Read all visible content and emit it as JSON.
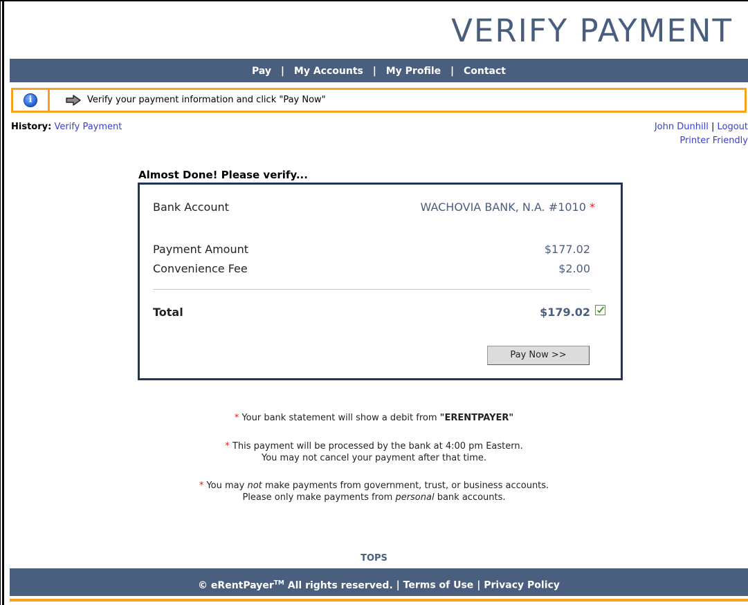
{
  "header": {
    "title": "VERIFY PAYMENT"
  },
  "nav": {
    "items": [
      "Pay",
      "My Accounts",
      "My Profile",
      "Contact"
    ],
    "separator": "|"
  },
  "notice": {
    "text": "Verify your payment information and click \"Pay Now\"",
    "info_icon": "i"
  },
  "history": {
    "label": "History:",
    "link": "Verify Payment"
  },
  "user": {
    "name": "John Dunhill",
    "separator": "|",
    "logout": "Logout",
    "printer": "Printer Friendly"
  },
  "verify": {
    "heading": "Almost Done! Please verify...",
    "bank_label": "Bank Account",
    "bank_value": "WACHOVIA BANK, N.A. #1010",
    "star": "*",
    "amount_label": "Payment Amount",
    "amount_value": "$177.02",
    "fee_label": "Convenience Fee",
    "fee_value": "$2.00",
    "total_label": "Total",
    "total_value": "$179.02",
    "button": "Pay Now >>"
  },
  "notes": {
    "note1_text": "Your bank statement will show a debit from",
    "note1_bold": "\"ERENTPAYER\"",
    "note2_line1": "This payment will be processed by the bank at 4:00 pm Eastern.",
    "note2_line2": "You may not cancel your payment after that time.",
    "note3_pre": "You may",
    "note3_em": "not",
    "note3_post": "make payments from government, trust, or business accounts.",
    "note3_line2_pre": "Please only make payments from",
    "note3_line2_em": "personal",
    "note3_line2_post": "bank accounts."
  },
  "footer": {
    "tops": "TOPS",
    "copyright": "© eRentPayer",
    "tm": "TM",
    "rights": "All rights reserved.",
    "terms": "Terms of Use",
    "privacy": "Privacy Policy",
    "separator": "|"
  },
  "colors": {
    "nav_bg": "#4a5e7d",
    "accent_orange": "#f5a21d",
    "link": "#3a40c8",
    "star": "#e21b1b",
    "box_border": "#22345a"
  }
}
